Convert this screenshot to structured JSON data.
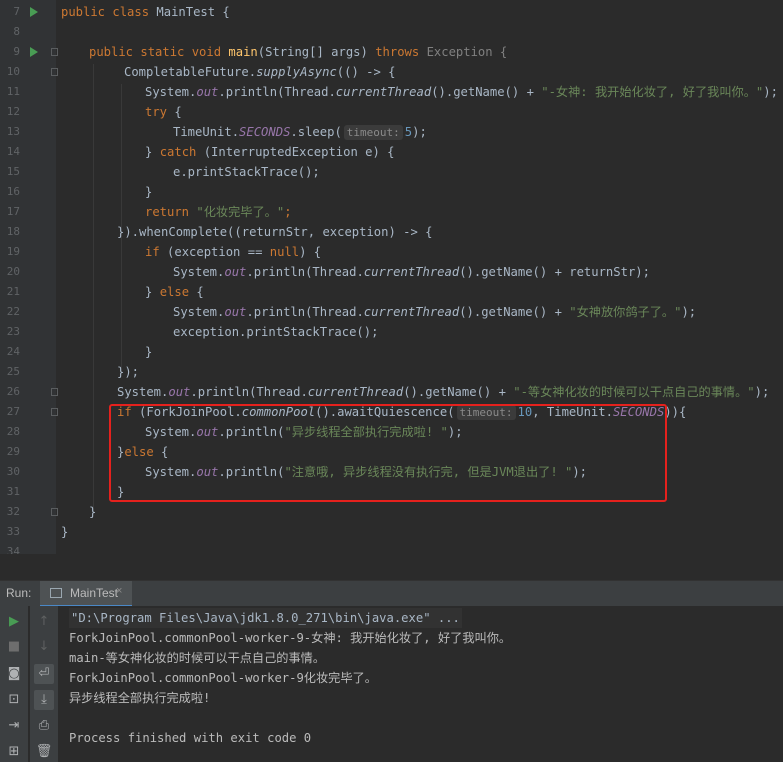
{
  "editor": {
    "line_numbers": [
      "7",
      "8",
      "9",
      "10",
      "11",
      "12",
      "13",
      "14",
      "15",
      "16",
      "17",
      "18",
      "19",
      "20",
      "21",
      "22",
      "23",
      "24",
      "25",
      "26",
      "27",
      "28",
      "29",
      "30",
      "31",
      "32",
      "33",
      "34"
    ],
    "hint_timeout": "timeout:",
    "lines": {
      "l7": [
        "public class ",
        "MainTest {"
      ],
      "l9": [
        "public static void ",
        "main",
        "(String[] args) ",
        "throws ",
        "Exception {"
      ],
      "l10": [
        "CompletableFuture.",
        "supplyAsync",
        "(() -> {"
      ],
      "l11": [
        "System.",
        "out",
        ".println(Thread.",
        "currentThread",
        "().getName() + ",
        "\"-女神: 我开始化妆了, 好了我叫你。\"",
        ");"
      ],
      "l12": [
        "try ",
        "{"
      ],
      "l13": [
        "TimeUnit.",
        "SECONDS",
        ".sleep(",
        "5",
        ");"
      ],
      "l14": [
        "} ",
        "catch ",
        "(InterruptedException e) {"
      ],
      "l15": [
        "e.printStackTrace();"
      ],
      "l16": [
        "}"
      ],
      "l17": [
        "return ",
        "\"化妆完毕了。\"",
        ";"
      ],
      "l18": [
        "}).whenComplete((returnStr, exception) -> {"
      ],
      "l19": [
        "if ",
        "(exception == ",
        "null",
        ") {"
      ],
      "l20": [
        "System.",
        "out",
        ".println(Thread.",
        "currentThread",
        "().getName() + returnStr);"
      ],
      "l21": [
        "} ",
        "else ",
        "{"
      ],
      "l22": [
        "System.",
        "out",
        ".println(Thread.",
        "currentThread",
        "().getName() + ",
        "\"女神放你鸽子了。\"",
        ");"
      ],
      "l23": [
        "exception.printStackTrace();"
      ],
      "l24": [
        "}"
      ],
      "l25": [
        "});"
      ],
      "l26": [
        "System.",
        "out",
        ".println(Thread.",
        "currentThread",
        "().getName() + ",
        "\"-等女神化妆的时候可以干点自己的事情。\"",
        ");"
      ],
      "l27": [
        "if ",
        "(ForkJoinPool.",
        "commonPool",
        "().awaitQuiescence(",
        "10",
        ", TimeUnit.",
        "SECONDS",
        ")){"
      ],
      "l28": [
        "System.",
        "out",
        ".println(",
        "\"异步线程全部执行完成啦! \"",
        ");"
      ],
      "l29": [
        "}",
        "else ",
        "{"
      ],
      "l30": [
        "System.",
        "out",
        ".println(",
        "\"注意哦, 异步线程没有执行完, 但是JVM退出了! \"",
        ");"
      ],
      "l31": [
        "}"
      ],
      "l32": [
        "}"
      ],
      "l33": [
        "}"
      ]
    }
  },
  "run_panel": {
    "label": "Run:",
    "tab_title": "MainTest",
    "tab_close": "×"
  },
  "console": {
    "lines": [
      "\"D:\\Program Files\\Java\\jdk1.8.0_271\\bin\\java.exe\" ...",
      "ForkJoinPool.commonPool-worker-9-女神: 我开始化妆了, 好了我叫你。",
      "main-等女神化妆的时候可以干点自己的事情。",
      "ForkJoinPool.commonPool-worker-9化妆完毕了。",
      "异步线程全部执行完成啦!",
      "",
      "Process finished with exit code 0"
    ]
  },
  "colors": {
    "highlight_box": "#e5211d",
    "run_arrow": "#499c54",
    "keyword": "#cc7832",
    "string": "#6a8759"
  }
}
